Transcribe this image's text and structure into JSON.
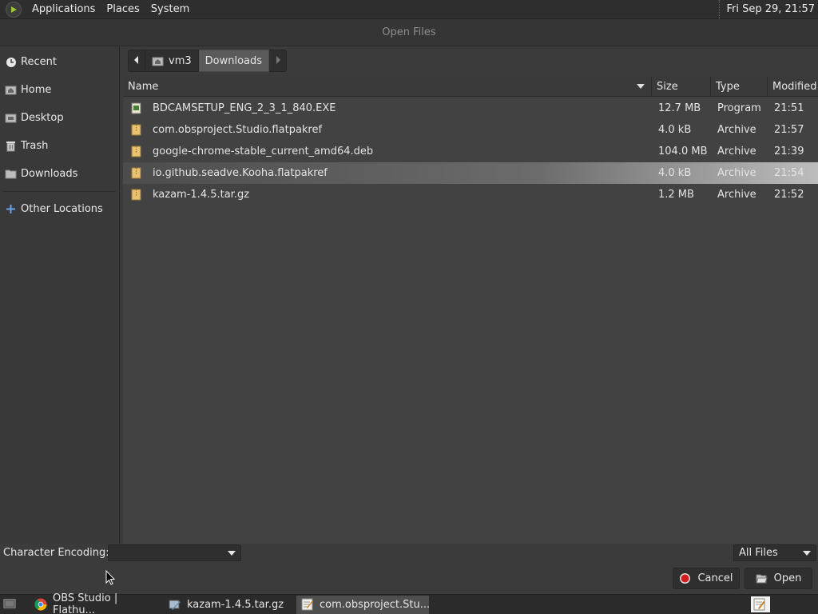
{
  "top_panel": {
    "menus": [
      "Applications",
      "Places",
      "System"
    ],
    "clock": "Fri Sep 29, 21:57"
  },
  "dialog": {
    "title": "Open Files"
  },
  "sidebar": {
    "items": [
      {
        "label": "Recent",
        "icon": "clock-icon"
      },
      {
        "label": "Home",
        "icon": "home-icon"
      },
      {
        "label": "Desktop",
        "icon": "desktop-icon"
      },
      {
        "label": "Trash",
        "icon": "trash-icon"
      },
      {
        "label": "Downloads",
        "icon": "folder-icon"
      }
    ],
    "other_locations": "Other Locations"
  },
  "pathbar": {
    "segments": [
      "vm3",
      "Downloads"
    ]
  },
  "file_list": {
    "columns": {
      "name": "Name",
      "size": "Size",
      "type": "Type",
      "modified": "Modified"
    },
    "rows": [
      {
        "name": "BDCAMSETUP_ENG_2_3_1_840.EXE",
        "size": "12.7 MB",
        "type": "Program",
        "modified": "21:51",
        "icon": "executable-icon"
      },
      {
        "name": "com.obsproject.Studio.flatpakref",
        "size": "4.0 kB",
        "type": "Archive",
        "modified": "21:57",
        "icon": "archive-icon"
      },
      {
        "name": "google-chrome-stable_current_amd64.deb",
        "size": "104.0 MB",
        "type": "Archive",
        "modified": "21:39",
        "icon": "archive-icon"
      },
      {
        "name": "io.github.seadve.Kooha.flatpakref",
        "size": "4.0 kB",
        "type": "Archive",
        "modified": "21:54",
        "icon": "archive-icon"
      },
      {
        "name": "kazam-1.4.5.tar.gz",
        "size": "1.2 MB",
        "type": "Archive",
        "modified": "21:52",
        "icon": "archive-icon"
      }
    ],
    "selected_index": 3
  },
  "bottom": {
    "encoding_label": "Character Encoding:",
    "encoding_value": "",
    "filter_value": "All Files",
    "cancel_label": "Cancel",
    "open_label": "Open"
  },
  "taskbar": {
    "tasks": [
      {
        "label": "OBS Studio | Flathu...",
        "icon": "chrome-icon"
      },
      {
        "label": "kazam-1.4.5.tar.gz",
        "icon": "file-manager-icon"
      },
      {
        "label": "com.obsproject.Stu...",
        "icon": "text-editor-icon"
      }
    ]
  }
}
